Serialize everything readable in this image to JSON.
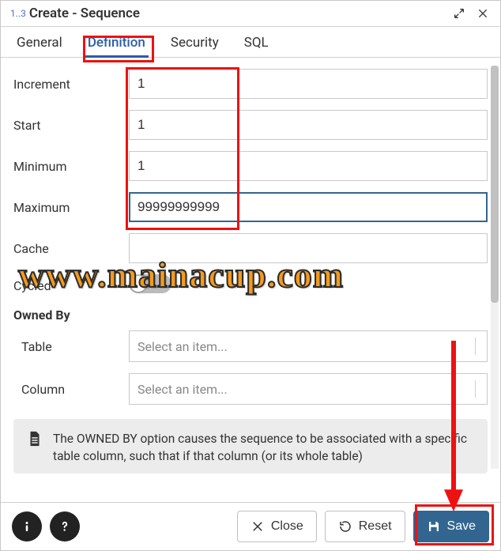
{
  "header": {
    "num": "1..3",
    "title": "Create - Sequence"
  },
  "tabs": {
    "general": "General",
    "definition": "Definition",
    "security": "Security",
    "sql": "SQL",
    "active": "definition"
  },
  "form": {
    "increment": {
      "label": "Increment",
      "value": "1"
    },
    "start": {
      "label": "Start",
      "value": "1"
    },
    "minimum": {
      "label": "Minimum",
      "value": "1"
    },
    "maximum": {
      "label": "Maximum",
      "value": "99999999999"
    },
    "cache": {
      "label": "Cache",
      "value": ""
    },
    "cycled": {
      "label": "Cycled",
      "value": false
    }
  },
  "owned_by": {
    "heading": "Owned By",
    "table": {
      "label": "Table",
      "placeholder": "Select an item..."
    },
    "column": {
      "label": "Column",
      "placeholder": "Select an item..."
    }
  },
  "info": {
    "text": "The OWNED BY option causes the sequence to be associated with a specific table column, such that if that column (or its whole table)"
  },
  "footer": {
    "close": "Close",
    "reset": "Reset",
    "save": "Save"
  },
  "watermark": "www.mainacup.com"
}
